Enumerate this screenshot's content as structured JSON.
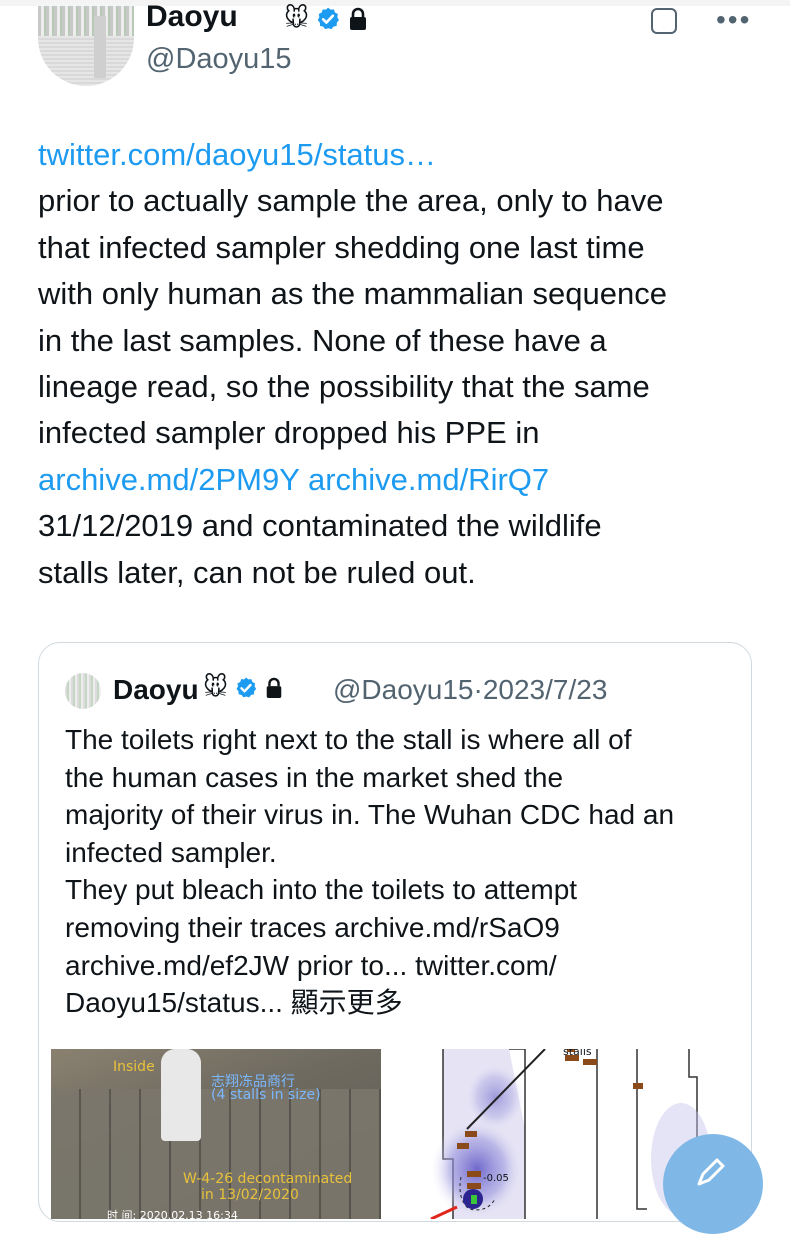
{
  "post": {
    "author": {
      "display_name": "Daoyu",
      "emoji": "🐭",
      "handle": "@Daoyu15"
    },
    "lines": [
      [
        {
          "text": "twitter.com/daoyu15/status…",
          "link": true
        }
      ],
      [
        {
          "text": "prior to actually sample the area, only to have",
          "link": false
        }
      ],
      [
        {
          "text": "that infected sampler shedding one last time",
          "link": false
        }
      ],
      [
        {
          "text": "with only human as the mammalian sequence",
          "link": false
        }
      ],
      [
        {
          "text": "in the last samples. None of these have a",
          "link": false
        }
      ],
      [
        {
          "text": "lineage read, so the possibility that the same",
          "link": false
        }
      ],
      [
        {
          "text": "infected sampler dropped his PPE in",
          "link": false
        }
      ],
      [
        {
          "text": "archive.md/2PM9Y",
          "link": true
        },
        {
          "text": " ",
          "link": false
        },
        {
          "text": "archive.md/RirQ7",
          "link": true
        }
      ],
      [
        {
          "text": "31/12/2019 and contaminated the wildlife",
          "link": false
        }
      ],
      [
        {
          "text": "stalls later, can not be ruled out.",
          "link": false
        }
      ]
    ]
  },
  "quoted": {
    "author": {
      "display_name": "Daoyu",
      "emoji": "🐭",
      "handle": "@Daoyu15",
      "separator": "·",
      "date": "2023/7/23"
    },
    "lines": [
      "The toilets right next to the stall is where all of",
      "the human cases in the market shed the",
      "majority of their virus in. The Wuhan CDC had an",
      "infected sampler.",
      "They put bleach into the toilets to attempt",
      "removing their traces archive.md/rSaO9",
      "archive.md/ef2JW prior to... twitter.com/",
      "Daoyu15/status... 顯示更多"
    ],
    "media": {
      "left_labels": {
        "inside": "Inside",
        "chinese": "志翔冻品商行",
        "size_note": "(4 stalls in size)",
        "decon": "W-4-26 decontaminated",
        "decon_date": "in 13/02/2020",
        "timestamp": "时 间: 2020.02.13 16:34"
      },
      "right_labels": {
        "stalls": "stalls",
        "contour": "-0.05"
      }
    }
  },
  "colors": {
    "link": "#1d9bf0",
    "verified": "#1d9bf0",
    "secondary_text": "#536471",
    "border": "#cfd9de"
  },
  "icons": [
    "verified-badge-icon",
    "lock-icon",
    "grok-icon",
    "more-icon",
    "compose-icon"
  ]
}
